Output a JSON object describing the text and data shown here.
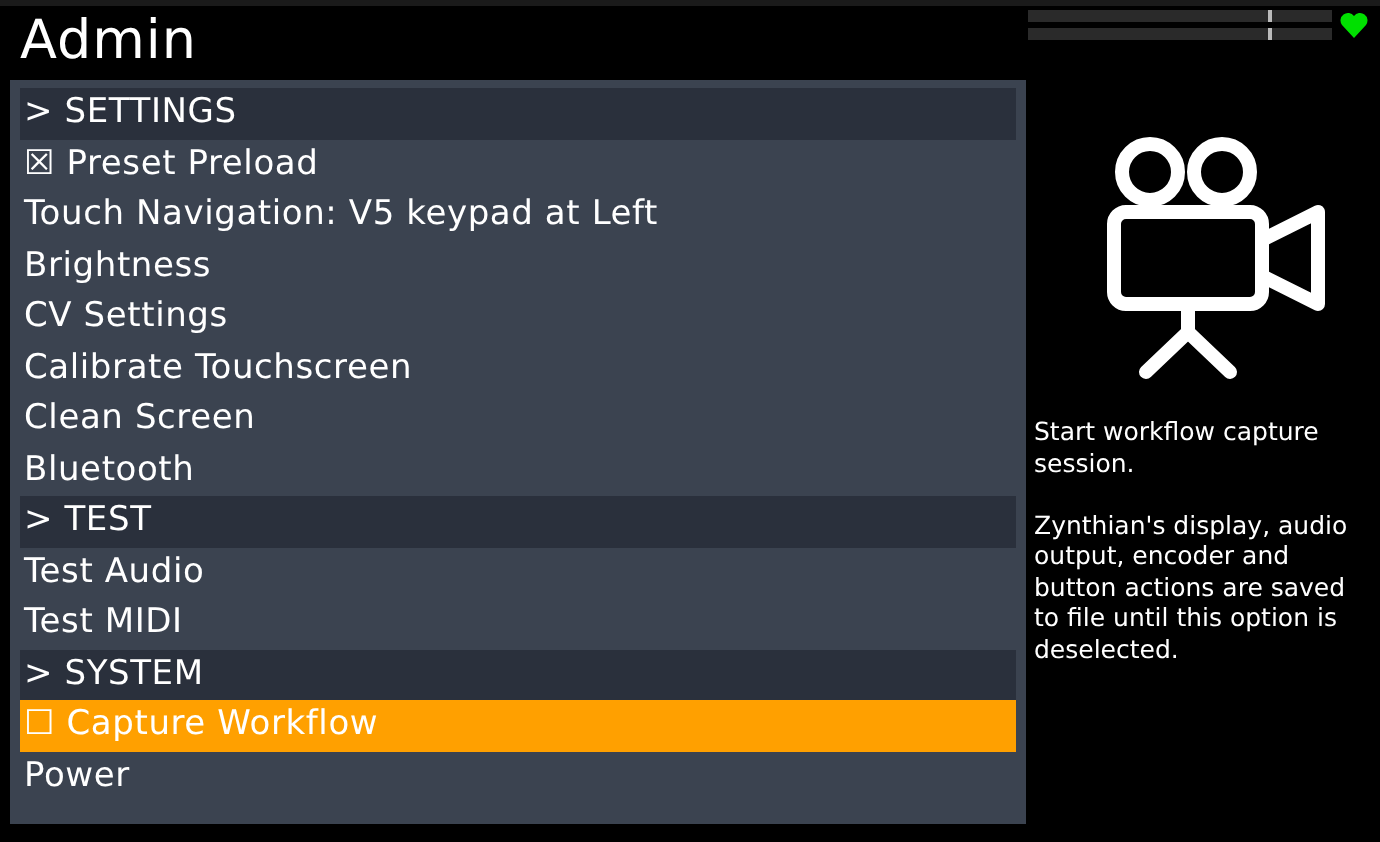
{
  "window": {
    "title": "Admin"
  },
  "menu": [
    {
      "kind": "header",
      "label": "> SETTINGS",
      "selected": false
    },
    {
      "kind": "item",
      "label": "☒ Preset Preload",
      "selected": false
    },
    {
      "kind": "item",
      "label": "Touch Navigation: V5 keypad at Left",
      "selected": false
    },
    {
      "kind": "item",
      "label": "Brightness",
      "selected": false
    },
    {
      "kind": "item",
      "label": "CV Settings",
      "selected": false
    },
    {
      "kind": "item",
      "label": "Calibrate Touchscreen",
      "selected": false
    },
    {
      "kind": "item",
      "label": "Clean Screen",
      "selected": false
    },
    {
      "kind": "item",
      "label": "Bluetooth",
      "selected": false
    },
    {
      "kind": "header",
      "label": "> TEST",
      "selected": false
    },
    {
      "kind": "item",
      "label": "Test Audio",
      "selected": false
    },
    {
      "kind": "item",
      "label": "Test MIDI",
      "selected": false
    },
    {
      "kind": "header",
      "label": "> SYSTEM",
      "selected": false
    },
    {
      "kind": "item",
      "label": "☐ Capture Workflow",
      "selected": true
    },
    {
      "kind": "item",
      "label": "Power",
      "selected": false
    }
  ],
  "info": {
    "paragraphs": [
      "Start workflow capture session.",
      "Zynthian's display, audio output, encoder and button actions are saved to file until this option is deselected."
    ]
  }
}
